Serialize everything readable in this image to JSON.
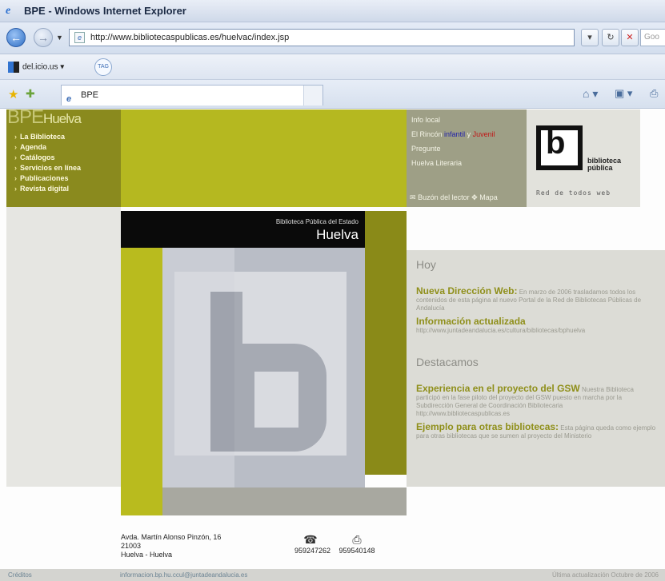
{
  "window": {
    "title": "BPE - Windows Internet Explorer"
  },
  "address_bar": {
    "url": "http://www.bibliotecaspublicas.es/huelvac/index.jsp",
    "search_placeholder": "Goo"
  },
  "links_bar": {
    "delicious": "del.icio.us",
    "tag": "TAG"
  },
  "tabs": [
    {
      "label": "BPE"
    }
  ],
  "logo": {
    "main": "BPE",
    "sub": "Huelva"
  },
  "nav": [
    {
      "label": "La Biblioteca"
    },
    {
      "label": "Agenda"
    },
    {
      "label": "Catálogos"
    },
    {
      "label": "Servicios en línea"
    },
    {
      "label": "Publicaciones"
    },
    {
      "label": "Revista digital"
    }
  ],
  "info_links": {
    "item1": "Info local",
    "item2_prefix": "El Rincón",
    "item2_infantil": "infantil",
    "item2_mid": "y",
    "item2_juvenil": "Juvenil",
    "item3": "Pregunte",
    "item4": "Huelva Literaria",
    "buzon": "Buzón del lector",
    "mapa": "Mapa"
  },
  "brand": {
    "name_line1": "biblioteca",
    "name_line2": "pública",
    "tagline": "Red de todos web"
  },
  "poster": {
    "subtitle": "Biblioteca Pública del Estado",
    "title": "Huelva"
  },
  "hoy": {
    "title": "Hoy",
    "items": [
      {
        "headline": "Nueva Dirección Web:",
        "text": "En marzo de 2006 trasladamos todos los contenidos de esta página al nuevo Portal de la Red de Bibliotecas Públicas de Andalucía"
      },
      {
        "headline": "Información actualizada",
        "text": "http://www.juntadeandalucia.es/cultura/bibliotecas/bphuelva"
      }
    ]
  },
  "destacamos": {
    "title": "Destacamos",
    "items": [
      {
        "headline": "Experiencia en el proyecto del GSW",
        "text": "Nuestra Biblioteca participó en la fase piloto del proyecto del GSW puesto en marcha por la Subdirección General de Coordinación Bibliotecaria http://www.bibliotecaspublicas.es"
      },
      {
        "headline": "Ejemplo para otras bibliotecas:",
        "text": "Esta página queda como ejemplo para otras bibliotecas que se sumen al proyecto del Ministerio"
      }
    ]
  },
  "address": {
    "line1": "Avda. Martín Alonso Pinzón, 16",
    "line2": "21003",
    "line3": "Huelva - Huelva"
  },
  "contact": {
    "phone": "959247262",
    "fax": "959540148"
  },
  "footer": {
    "credits": "Créditos",
    "email": "informacion.bp.hu.ccul@juntadeandalucia.es",
    "updated": "Última actualización Octubre de 2006"
  }
}
